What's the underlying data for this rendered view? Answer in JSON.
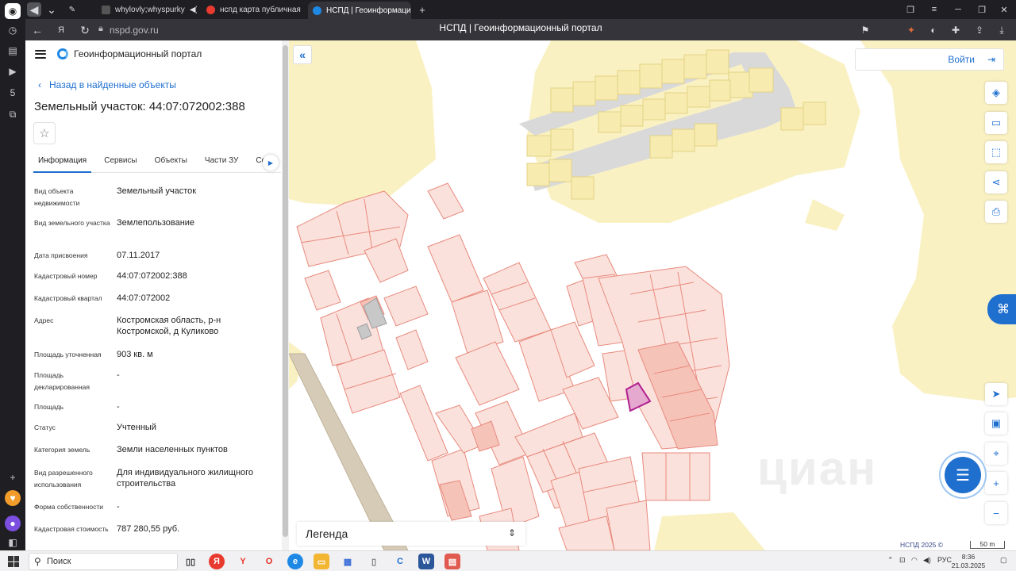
{
  "browser": {
    "tabs": [
      {
        "label": "whylovly;whyspurky"
      },
      {
        "label": "нспд карта публичная кад"
      },
      {
        "label": "НСПД | Геоинформацио"
      }
    ],
    "url": "nspd.gov.ru",
    "page_title": "НСПД | Геоинформационный портал"
  },
  "site": {
    "name": "Геоинформационный портал",
    "back_label": "Назад в найденные объекты",
    "object_title": "Земельный участок: 44:07:072002:388",
    "tabs": [
      {
        "label": "Информация"
      },
      {
        "label": "Сервисы"
      },
      {
        "label": "Объекты"
      },
      {
        "label": "Части ЗУ"
      },
      {
        "label": "Соста"
      }
    ],
    "properties": [
      {
        "label": "Вид объекта недвижимости",
        "value": "Земельный участок"
      },
      {
        "label": "Вид земельного участка",
        "value": "Землепользование"
      },
      {
        "label": "Дата присвоения",
        "value": "07.11.2017"
      },
      {
        "label": "Кадастровый номер",
        "value": "44:07:072002:388"
      },
      {
        "label": "Кадастровый квартал",
        "value": "44:07:072002"
      },
      {
        "label": "Адрес",
        "value": "Костромская область, р-н Костромской, д Куликово"
      },
      {
        "label": "Площадь уточненная",
        "value": "903 кв. м"
      },
      {
        "label": "Площадь декларированная",
        "value": "-"
      },
      {
        "label": "Площадь",
        "value": "-"
      },
      {
        "label": "Статус",
        "value": "Учтенный"
      },
      {
        "label": "Категория земель",
        "value": "Земли населенных пунктов"
      },
      {
        "label": "Вид разрешенного использования",
        "value": "Для индивидуального жилищного строительства"
      },
      {
        "label": "Форма собственности",
        "value": "-"
      },
      {
        "label": "Кадастровая стоимость",
        "value": "787 280,55 руб."
      }
    ]
  },
  "map": {
    "login_label": "Войти",
    "legend_label": "Легенда",
    "credit": "НСПД 2025 ©",
    "scale_label": "50 m",
    "watermark": "циан",
    "colors": {
      "background": "#ffffff",
      "zone_fill": "#faf1c3",
      "parcel_fill": "#fbe1dc",
      "parcel_stroke": "#e88a7d",
      "selected_stroke": "#b0208f",
      "accent": "#1f6fcf"
    }
  },
  "taskbar": {
    "search_label": "Поиск",
    "lang": "РУС",
    "time": "8:36",
    "date": "21.03.2025"
  }
}
